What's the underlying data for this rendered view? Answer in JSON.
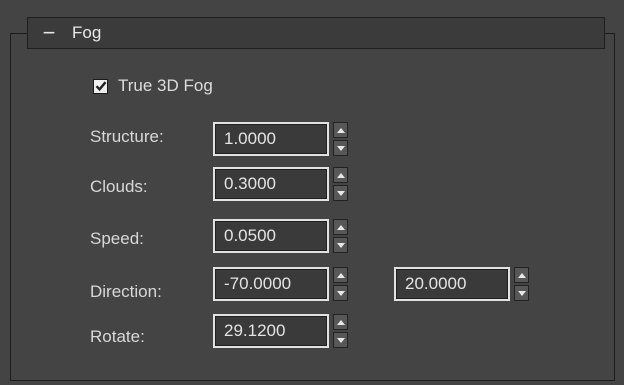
{
  "rollout": {
    "collapse_symbol": "−",
    "title": "Fog"
  },
  "true3d": {
    "label": "True 3D Fog",
    "checked": true
  },
  "params": {
    "structure": {
      "label": "Structure:",
      "value": "1.0000"
    },
    "clouds": {
      "label": "Clouds:",
      "value": "0.3000"
    },
    "speed": {
      "label": "Speed:",
      "value": "0.0500"
    },
    "direction": {
      "label": "Direction:",
      "value": "-70.0000",
      "value2": "20.0000"
    },
    "rotate": {
      "label": "Rotate:",
      "value": "29.1200"
    }
  },
  "icons": {
    "spinner_up": "triangle-up-icon",
    "spinner_down": "triangle-down-icon",
    "check": "checkmark-icon"
  },
  "colors": {
    "background": "#444444",
    "field_border": "#e2e2e2",
    "text": "#d8d8d8"
  }
}
